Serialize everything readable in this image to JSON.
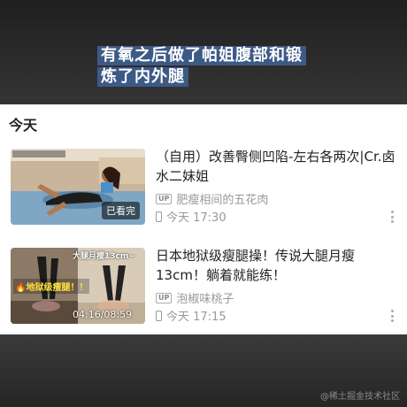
{
  "caption": {
    "line1": "有氧之后做了帕姐腹部和锻",
    "line2": "炼了内外腿"
  },
  "section": {
    "title": "今天"
  },
  "history": [
    {
      "title": "（自用）改善臀侧凹陷-左右各两次|Cr.卤水二妹姐",
      "up_badge": "UP",
      "uploader": "肥瘦相间的五花肉",
      "time": "今天 17:30",
      "status_badge": "已看完"
    },
    {
      "title": "日本地狱级瘦腿操！传说大腿月瘦13cm！躺着就能练！",
      "up_badge": "UP",
      "uploader": "泡椒味桃子",
      "time": "今天 17:15",
      "progress_text": "04:16/08:59",
      "thumb_text_left": "🔥地狱级瘦腿！！",
      "thumb_text_top": "大腿月瘦13cm~"
    }
  ],
  "watermark": "@稀土掘金技术社区",
  "icons": [
    "up-icon",
    "phone-icon",
    "more-icon"
  ],
  "colors": {
    "caption_bg": "#3d5a87",
    "panel_bg": "#ffffff",
    "meta_text": "#999999"
  }
}
